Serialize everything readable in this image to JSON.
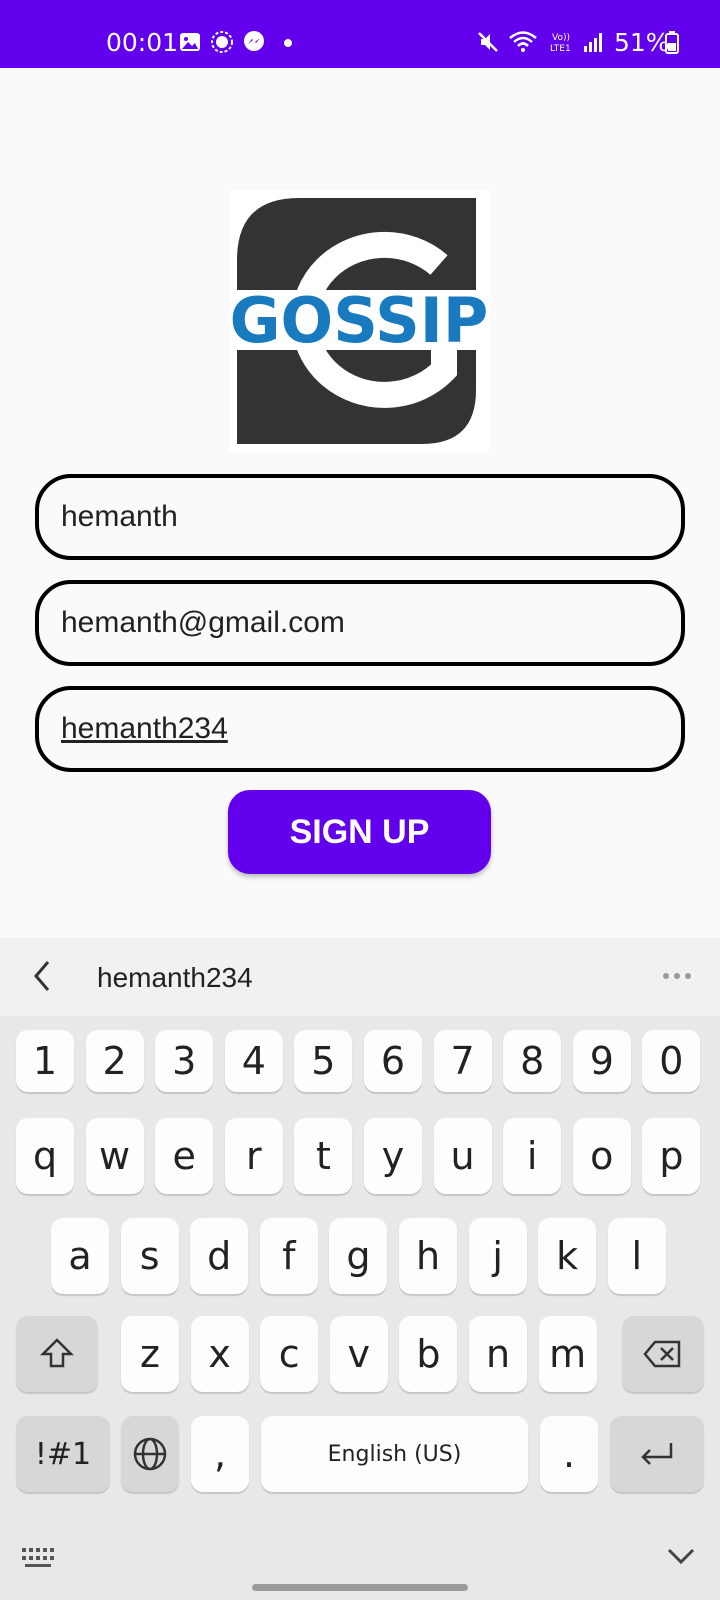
{
  "status_bar": {
    "time": "00:01",
    "battery": "51%",
    "icons": [
      "gallery-icon",
      "signal-app-icon",
      "messenger-icon",
      "notification-dot",
      "mute-icon",
      "wifi-icon",
      "volte-icon",
      "cell-signal-icon",
      "battery-icon"
    ]
  },
  "logo": {
    "text": "GOSSIP",
    "icon": "gossip-logo",
    "colors": {
      "dark": "#333333",
      "blue": "#1a7abf"
    }
  },
  "form": {
    "username_value": "hemanth",
    "email_value": "hemanth@gmail.com",
    "password_value": "hemanth234",
    "signup_label": "SIGN UP"
  },
  "keyboard": {
    "suggestion": "hemanth234",
    "row_numbers": [
      "1",
      "2",
      "3",
      "4",
      "5",
      "6",
      "7",
      "8",
      "9",
      "0"
    ],
    "row1": [
      "q",
      "w",
      "e",
      "r",
      "t",
      "y",
      "u",
      "i",
      "o",
      "p"
    ],
    "row2": [
      "a",
      "s",
      "d",
      "f",
      "g",
      "h",
      "j",
      "k",
      "l"
    ],
    "row3": [
      "z",
      "x",
      "c",
      "v",
      "b",
      "n",
      "m"
    ],
    "symbols_label": "!#1",
    "comma": ",",
    "space_label": "English (US)",
    "period": "."
  },
  "colors": {
    "accent": "#6200ee",
    "keyboard_bg": "#e8e8e8"
  }
}
